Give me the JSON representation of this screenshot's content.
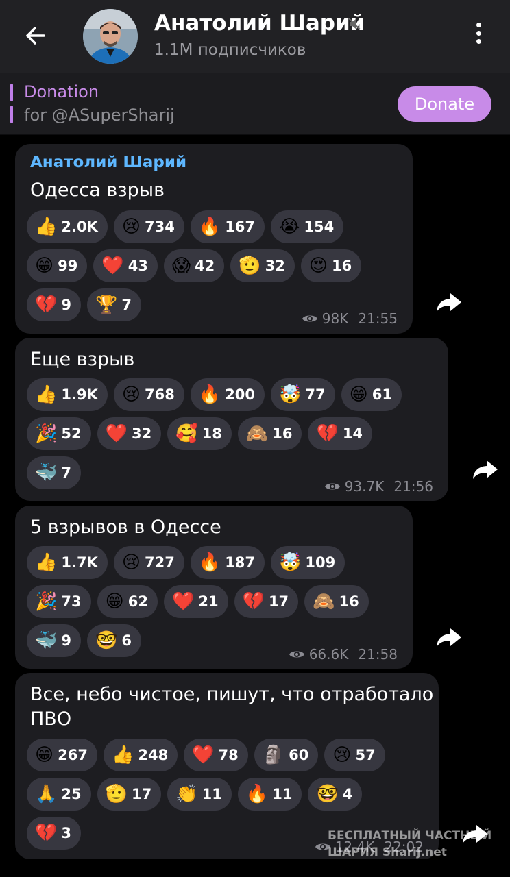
{
  "header": {
    "title": "Анатолий Шарий",
    "subscribers": "1.1M подписчиков"
  },
  "pinned": {
    "title": "Donation",
    "subtitle": "for @ASuperSharij",
    "button": "Donate"
  },
  "messages": [
    {
      "sender": "Анатолий Шарий",
      "text": "Одесса взрыв",
      "views": "98K",
      "time": "21:55",
      "reactions": [
        [
          {
            "emoji": "👍",
            "count": "2.0K"
          },
          {
            "emoji": "😢",
            "count": "734"
          },
          {
            "emoji": "🔥",
            "count": "167"
          },
          {
            "emoji": "😭",
            "count": "154"
          }
        ],
        [
          {
            "emoji": "😁",
            "count": "99"
          },
          {
            "emoji": "❤️",
            "count": "43"
          },
          {
            "emoji": "😱",
            "count": "42"
          },
          {
            "emoji": "🫡",
            "count": "32"
          },
          {
            "emoji": "😍",
            "count": "16"
          }
        ],
        [
          {
            "emoji": "💔",
            "count": "9"
          },
          {
            "emoji": "🏆",
            "count": "7"
          }
        ]
      ]
    },
    {
      "text": "Еще взрыв",
      "views": "93.7K",
      "time": "21:56",
      "reactions": [
        [
          {
            "emoji": "👍",
            "count": "1.9K"
          },
          {
            "emoji": "😢",
            "count": "768"
          },
          {
            "emoji": "🔥",
            "count": "200"
          },
          {
            "emoji": "🤯",
            "count": "77"
          },
          {
            "emoji": "😁",
            "count": "61"
          }
        ],
        [
          {
            "emoji": "🎉",
            "count": "52"
          },
          {
            "emoji": "❤️",
            "count": "32"
          },
          {
            "emoji": "🥰",
            "count": "18"
          },
          {
            "emoji": "🙈",
            "count": "16"
          },
          {
            "emoji": "💔",
            "count": "14"
          }
        ],
        [
          {
            "emoji": "🐳",
            "count": "7"
          }
        ]
      ]
    },
    {
      "text": "5 взрывов в Одессе",
      "views": "66.6K",
      "time": "21:58",
      "reactions": [
        [
          {
            "emoji": "👍",
            "count": "1.7K"
          },
          {
            "emoji": "😢",
            "count": "727"
          },
          {
            "emoji": "🔥",
            "count": "187"
          },
          {
            "emoji": "🤯",
            "count": "109"
          }
        ],
        [
          {
            "emoji": "🎉",
            "count": "73"
          },
          {
            "emoji": "😁",
            "count": "62"
          },
          {
            "emoji": "❤️",
            "count": "21"
          },
          {
            "emoji": "💔",
            "count": "17"
          },
          {
            "emoji": "🙈",
            "count": "16"
          }
        ],
        [
          {
            "emoji": "🐳",
            "count": "9"
          },
          {
            "emoji": "🤓",
            "count": "6"
          }
        ]
      ]
    },
    {
      "text": "Все, небо чистое, пишут, что отработало ПВО",
      "views": "12.4K",
      "time": "22:02",
      "reactions": [
        [
          {
            "emoji": "😁",
            "count": "267"
          },
          {
            "emoji": "👍",
            "count": "248"
          },
          {
            "emoji": "❤️",
            "count": "78"
          },
          {
            "emoji": "🗿",
            "count": "60"
          },
          {
            "emoji": "😢",
            "count": "57"
          }
        ],
        [
          {
            "emoji": "🙏",
            "count": "25"
          },
          {
            "emoji": "🫡",
            "count": "17"
          },
          {
            "emoji": "👏",
            "count": "11"
          },
          {
            "emoji": "🔥",
            "count": "11"
          },
          {
            "emoji": "🤓",
            "count": "4"
          }
        ],
        [
          {
            "emoji": "💔",
            "count": "3"
          }
        ]
      ]
    }
  ],
  "watermark": {
    "line1": "БЕСПЛАТНЫЙ ЧАСТНЫЙ",
    "line2": "ШАРИЯ",
    "line3": "Sharij.net"
  },
  "colors": {
    "accent": "#c88be8",
    "sender": "#5eb7ff",
    "bubble": "#1d1d21",
    "chip": "#373740"
  }
}
